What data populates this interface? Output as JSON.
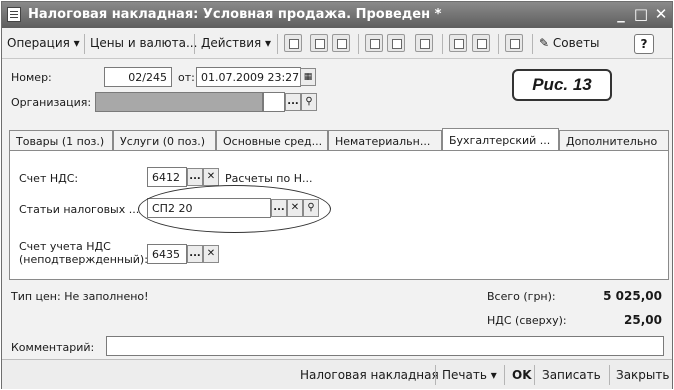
{
  "window": {
    "title": "Налоговая накладная: Условная продажа. Проведен *",
    "minimize": "_",
    "maximize": "□",
    "close": "✕"
  },
  "toolbar": {
    "operation": "Операция ▾",
    "prices": "Цены и валюта...",
    "actions": "Действия ▾",
    "tips": "Советы",
    "help": "?"
  },
  "form": {
    "number_label": "Номер:",
    "number_value": "02/245",
    "from_label": "от:",
    "date_value": "01.07.2009 23:27",
    "org_label": "Организация:",
    "figure_label": "Рис. 13"
  },
  "tabs": [
    {
      "label": "Товары (1 поз.)"
    },
    {
      "label": "Услуги (0 поз.)"
    },
    {
      "label": "Основные сред..."
    },
    {
      "label": "Нематериальн..."
    },
    {
      "label": "Бухгалтерский ..."
    },
    {
      "label": "Дополнительно"
    }
  ],
  "panel": {
    "vat_account_label": "Счет НДС:",
    "vat_account_value": "6412",
    "vat_account_desc": "Расчеты по Н...",
    "tax_items_label": "Статьи налоговых ...",
    "tax_items_value": "СП2 20",
    "unconfirmed_label_1": "Счет учета НДС",
    "unconfirmed_label_2": "(неподтвержденный):",
    "unconfirmed_value": "6435"
  },
  "summary": {
    "price_type": "Тип цен: Не заполнено!",
    "total_label": "Всего (грн):",
    "total_value": "5 025,00",
    "vat_label": "НДС (сверху):",
    "vat_value": "25,00",
    "comment_label": "Комментарий:"
  },
  "bottombar": {
    "tax_invoice": "Налоговая накладная",
    "print": "Печать ▾",
    "ok": "OK",
    "save": "Записать",
    "close": "Закрыть"
  },
  "colors": {
    "titlebar": "#6e6e6e",
    "org_field": "#a8a8a8"
  }
}
